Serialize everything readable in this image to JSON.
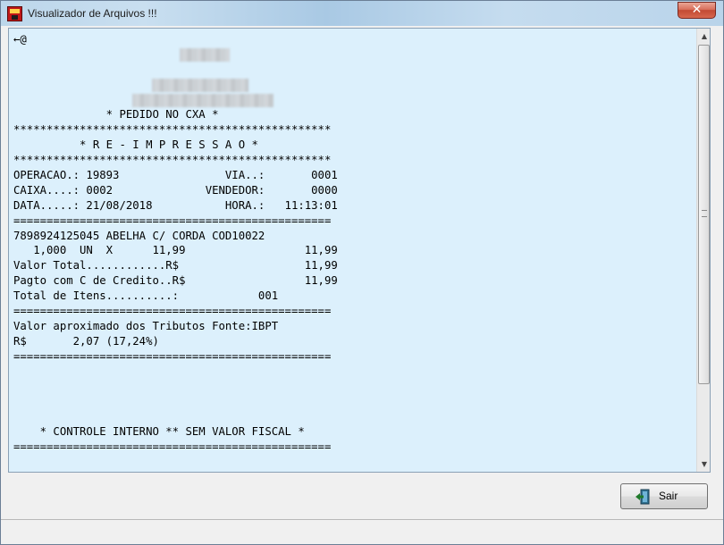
{
  "window": {
    "title": "Visualizador de Arquivos !!!",
    "close_glyph": "✕"
  },
  "document": {
    "lines": {
      "l1": "←@",
      "l6": "              * PEDIDO NO CXA *",
      "l7": "************************************************",
      "l8": "          * R E - I M P R E S S A O *",
      "l9": "************************************************",
      "l10": "OPERACAO.: 19893                VIA..:       0001",
      "l11": "CAIXA....: 0002              VENDEDOR:       0000",
      "l12": "DATA.....: 21/08/2018           HORA.:   11:13:01",
      "l13": "================================================",
      "l14": "7898924125045 ABELHA C/ CORDA COD10022",
      "l15": "   1,000  UN  X      11,99                  11,99",
      "l16": "Valor Total............R$                   11,99",
      "l17": "Pagto com C de Credito..R$                  11,99",
      "l18": "Total de Itens..........:            001",
      "l19": "================================================",
      "l20": "Valor aproximado dos Tributos Fonte:IBPT",
      "l21": "R$       2,07 (17,24%)",
      "l22": "================================================",
      "l27": "    * CONTROLE INTERNO ** SEM VALOR FISCAL *",
      "l28": "================================================"
    }
  },
  "buttons": {
    "sair_label": "Sair"
  },
  "icons": {
    "app": "app-icon",
    "close": "close-icon",
    "sair": "exit-door-icon",
    "scroll_up": "scroll-up-arrow-icon",
    "scroll_down": "scroll-down-arrow-icon"
  },
  "colors": {
    "document_background": "#dcf0fc",
    "close_button": "#c24a33",
    "window_background": "#f0f0f0"
  }
}
